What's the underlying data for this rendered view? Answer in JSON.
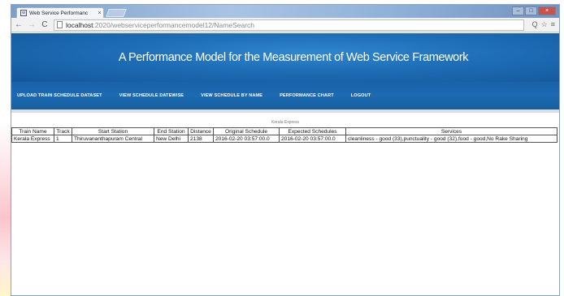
{
  "browser": {
    "tab_title": "Web Service Performanc",
    "tab_close": "×",
    "url_host": "localhost",
    "url_path": ":2020/webserviceperformancemodel12/NameSearch",
    "back": "←",
    "forward": "→",
    "reload": "C",
    "zoom_icon": "Q",
    "star_icon": "☆",
    "menu_icon": "≡",
    "win_min": "–",
    "win_max": "□",
    "win_close": "×"
  },
  "header": {
    "title": "A Performance Model for the Measurement of Web Service Framework"
  },
  "nav": {
    "items": [
      "UPLOAD TRAIN SCHEDULE DATASET",
      "VIEW SCHEDULE DATEWISE",
      "VIEW SCHEDULE BY NAME",
      "PERFORMANCE CHART",
      "LOGOUT"
    ]
  },
  "result": {
    "caption": "Kerala Express",
    "columns": [
      "Train Name",
      "Track",
      "Start Station",
      "End Station",
      "Distance",
      "Original Schedule",
      "Expected Schedules",
      "Services"
    ],
    "rows": [
      [
        "Kerala Express",
        "1",
        "Thiruvananthapuram Central",
        "New Delhi",
        "2138",
        "2016-02-20 03:57:00.0",
        "2016-02-20 03:57:00.0",
        "cleanliness - good (33),punctuality - good (32),food - good,No Rake Sharing"
      ]
    ]
  }
}
